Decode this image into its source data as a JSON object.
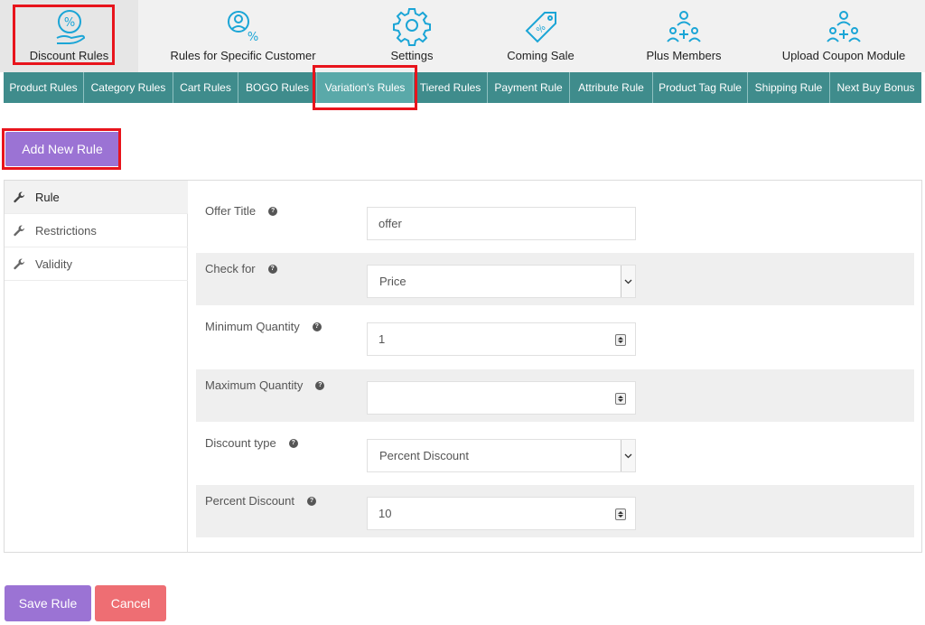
{
  "top_nav": [
    {
      "label": "Discount Rules",
      "icon": "percent-hand-icon"
    },
    {
      "label": "Rules for Specific Customer",
      "icon": "customer-percent-icon"
    },
    {
      "label": "Settings",
      "icon": "gear-icon"
    },
    {
      "label": "Coming Sale",
      "icon": "price-tag-icon"
    },
    {
      "label": "Plus Members",
      "icon": "members-plus-icon"
    },
    {
      "label": "Upload Coupon Module",
      "icon": "members-upload-icon"
    }
  ],
  "tabs": [
    "Product Rules",
    "Category Rules",
    "Cart Rules",
    "BOGO Rules",
    "Variation's Rules",
    "Tiered Rules",
    "Payment Rule",
    "Attribute Rule",
    "Product Tag Rule",
    "Shipping Rule",
    "Next Buy Bonus"
  ],
  "active_tab": "Variation's Rules",
  "add_new_rule": "Add New Rule",
  "sidebar": [
    "Rule",
    "Restrictions",
    "Validity"
  ],
  "form": {
    "offer_title": {
      "label": "Offer Title",
      "value": "offer"
    },
    "check_for": {
      "label": "Check for",
      "value": "Price"
    },
    "min_qty": {
      "label": "Minimum Quantity",
      "value": "1"
    },
    "max_qty": {
      "label": "Maximum Quantity",
      "value": ""
    },
    "discount_type": {
      "label": "Discount type",
      "value": "Percent Discount"
    },
    "percent_discount": {
      "label": "Percent Discount",
      "value": "10"
    }
  },
  "help_glyph": "?",
  "save_label": "Save Rule",
  "cancel_label": "Cancel",
  "colors": {
    "accent": "#3f8c8c",
    "purple": "#9b73d4",
    "cancel": "#ee6e73",
    "icon_blue": "#1ba5d6",
    "highlight": "#e8141c"
  }
}
